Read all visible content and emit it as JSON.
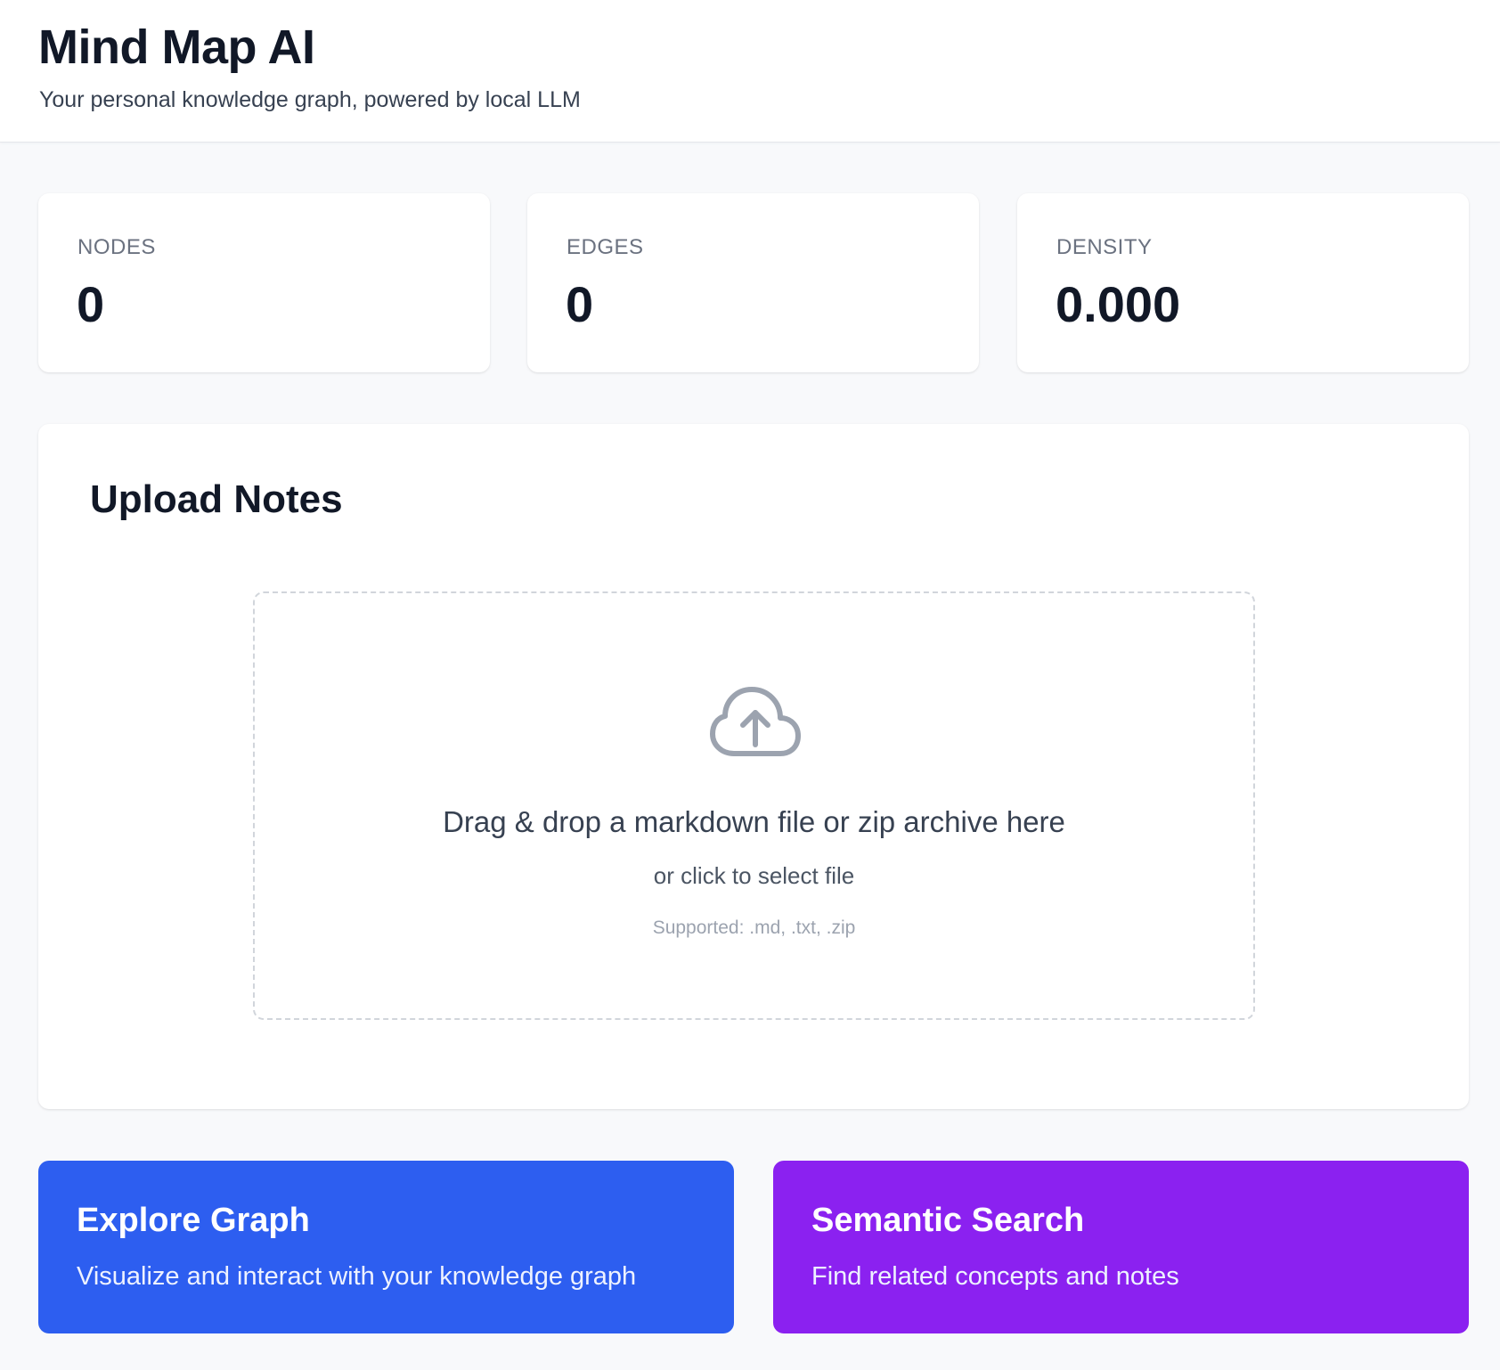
{
  "header": {
    "title": "Mind Map AI",
    "subtitle": "Your personal knowledge graph, powered by local LLM"
  },
  "stats": [
    {
      "label": "NODES",
      "value": "0"
    },
    {
      "label": "EDGES",
      "value": "0"
    },
    {
      "label": "DENSITY",
      "value": "0.000"
    }
  ],
  "upload": {
    "title": "Upload Notes",
    "icon": "cloud-upload-icon",
    "drop_text": "Drag & drop a markdown file or zip archive here",
    "click_text": "or click to select file",
    "supported_text": "Supported: .md, .txt, .zip"
  },
  "actions": [
    {
      "title": "Explore Graph",
      "description": "Visualize and interact with your knowledge graph",
      "color": "#2d5ef0"
    },
    {
      "title": "Semantic Search",
      "description": "Find related concepts and notes",
      "color": "#8b21f0"
    }
  ],
  "colors": {
    "background": "#f8f9fb",
    "card": "#ffffff",
    "text_primary": "#111827",
    "text_muted": "#6b7280",
    "explore": "#2d5ef0",
    "search": "#8b21f0"
  }
}
